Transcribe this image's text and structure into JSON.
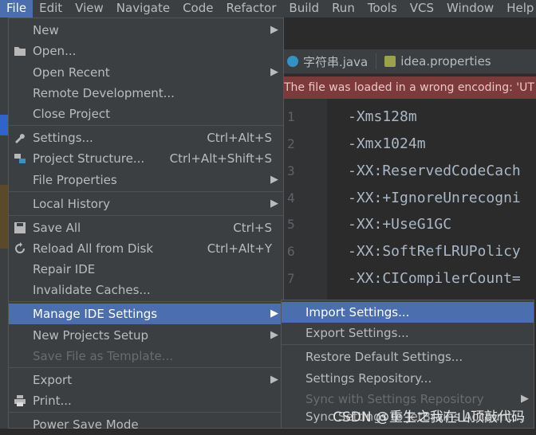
{
  "menubar": {
    "items": [
      {
        "label": "File",
        "active": true
      },
      {
        "label": "Edit"
      },
      {
        "label": "View"
      },
      {
        "label": "Navigate"
      },
      {
        "label": "Code"
      },
      {
        "label": "Refactor"
      },
      {
        "label": "Build"
      },
      {
        "label": "Run"
      },
      {
        "label": "Tools"
      },
      {
        "label": "VCS"
      },
      {
        "label": "Window"
      },
      {
        "label": "Help"
      }
    ]
  },
  "editor": {
    "tabs": [
      {
        "label": "字符串.java"
      },
      {
        "label": "idea.properties"
      }
    ],
    "banner": "The file was loaded in a wrong encoding: 'UT",
    "lines": [
      {
        "num": "1",
        "text": "-Xms128m"
      },
      {
        "num": "2",
        "text": "-Xmx1024m"
      },
      {
        "num": "3",
        "text": "-XX:ReservedCodeCach"
      },
      {
        "num": "4",
        "text": "-XX:+IgnoreUnrecogni"
      },
      {
        "num": "5",
        "text": "-XX:+UseG1GC"
      },
      {
        "num": "6",
        "text": "-XX:SoftRefLRUPolicy"
      },
      {
        "num": "7",
        "text": "-XX:CICompilerCount="
      }
    ]
  },
  "file_menu": {
    "items": [
      {
        "label": "New"
      },
      {
        "label": "Open..."
      },
      {
        "label": "Open Recent"
      },
      {
        "label": "Remote Development..."
      },
      {
        "label": "Close Project"
      },
      {
        "label": "Settings...",
        "shortcut": "Ctrl+Alt+S"
      },
      {
        "label": "Project Structure...",
        "shortcut": "Ctrl+Alt+Shift+S"
      },
      {
        "label": "File Properties"
      },
      {
        "label": "Local History"
      },
      {
        "label": "Save All",
        "shortcut": "Ctrl+S"
      },
      {
        "label": "Reload All from Disk",
        "shortcut": "Ctrl+Alt+Y"
      },
      {
        "label": "Repair IDE"
      },
      {
        "label": "Invalidate Caches..."
      },
      {
        "label": "Manage IDE Settings"
      },
      {
        "label": "New Projects Setup"
      },
      {
        "label": "Save File as Template..."
      },
      {
        "label": "Export"
      },
      {
        "label": "Print..."
      },
      {
        "label": "Power Save Mode"
      }
    ]
  },
  "sub_menu": {
    "items": [
      {
        "label": "Import Settings..."
      },
      {
        "label": "Export Settings..."
      },
      {
        "label": "Restore Default Settings..."
      },
      {
        "label": "Settings Repository..."
      },
      {
        "label": "Sync with Settings Repository"
      },
      {
        "label": "Sync Settings to JetBrains Account..."
      }
    ]
  },
  "watermark": "CSDN @重生之我在山顶敲代码",
  "colors": {
    "highlight": "#4b6eaf",
    "banner": "#7d3a3a",
    "menu_bg": "#3c3f41"
  }
}
